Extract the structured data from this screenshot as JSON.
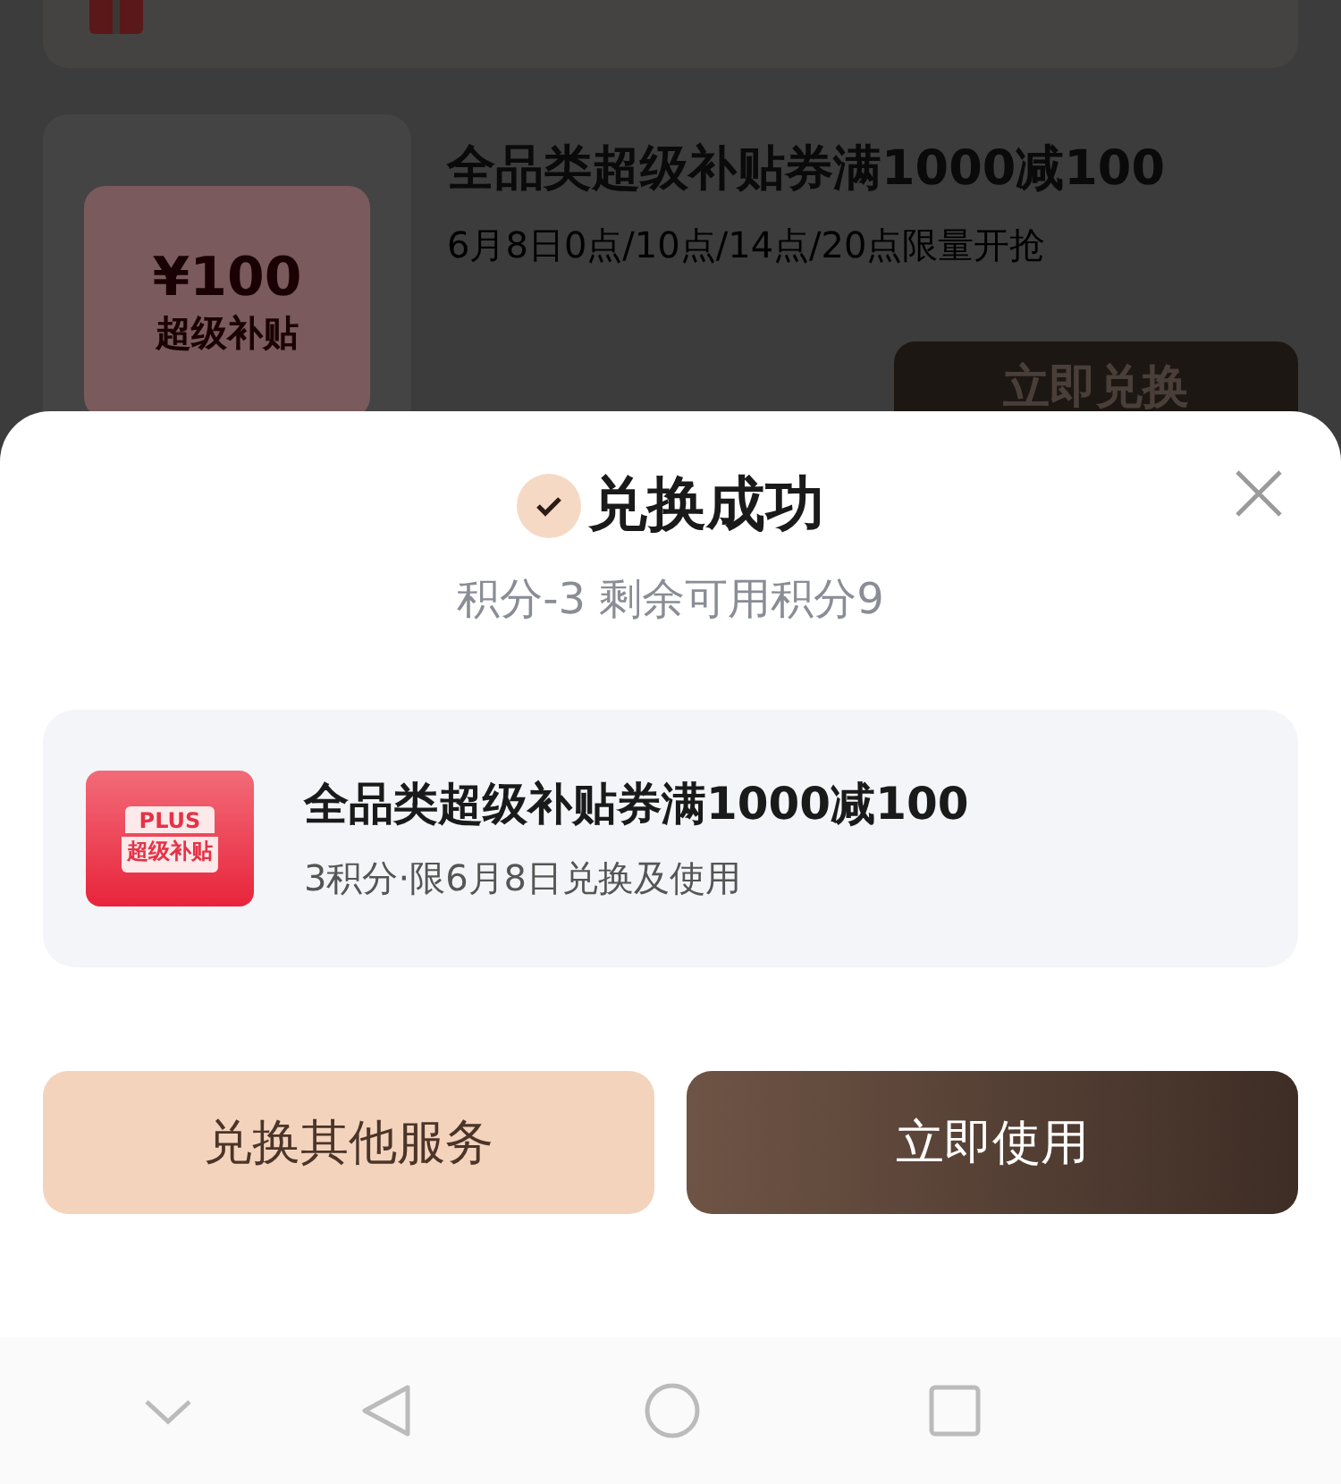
{
  "background": {
    "coupon": {
      "amount": "¥100",
      "label": "超级补贴",
      "title": "全品类超级补贴券满1000减100",
      "subtitle": "6月8日0点/10点/14点/20点限量开抢",
      "button": "立即兑换"
    }
  },
  "dialog": {
    "title": "兑换成功",
    "subtitle": "积分-3 剩余可用积分9",
    "item": {
      "badge_top": "PLUS",
      "badge_bottom": "超级补贴",
      "title": "全品类超级补贴券满1000减100",
      "detail": "3积分·限6月8日兑换及使用"
    },
    "buttons": [
      {
        "label": "兑换其他服务",
        "kind": "secondary"
      },
      {
        "label": "立即使用",
        "kind": "primary"
      }
    ]
  }
}
